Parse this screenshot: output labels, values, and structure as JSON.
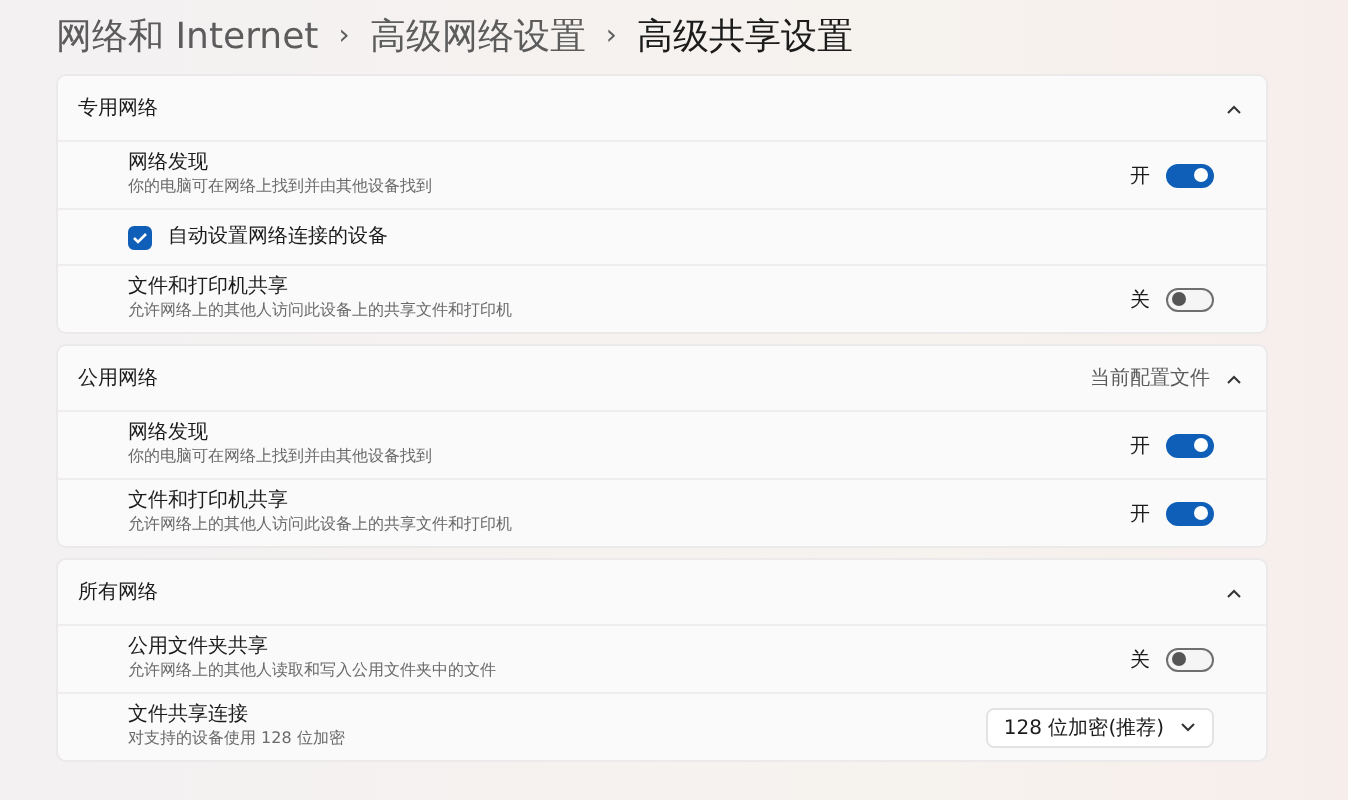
{
  "breadcrumb": [
    {
      "label": "网络和 Internet",
      "current": false
    },
    {
      "separator": "›",
      "label": "高级网络设置",
      "current": false
    },
    {
      "separator": "›",
      "label": "高级共享设置",
      "current": true
    }
  ],
  "sections": [
    {
      "title": "专用网络",
      "expanded": true,
      "rows": [
        {
          "kind": "toggle",
          "title": "网络发现",
          "subtitle": "你的电脑可在网络上找到并由其他设备找到",
          "on": true,
          "state_label": "开"
        },
        {
          "kind": "checkbox",
          "label": "自动设置网络连接的设备",
          "checked": true
        },
        {
          "kind": "toggle",
          "title": "文件和打印机共享",
          "subtitle": "允许网络上的其他人访问此设备上的共享文件和打印机",
          "on": false,
          "state_label": "关"
        }
      ]
    },
    {
      "title": "公用网络",
      "note": "当前配置文件",
      "expanded": true,
      "rows": [
        {
          "kind": "toggle",
          "title": "网络发现",
          "subtitle": "你的电脑可在网络上找到并由其他设备找到",
          "on": true,
          "state_label": "开"
        },
        {
          "kind": "toggle",
          "title": "文件和打印机共享",
          "subtitle": "允许网络上的其他人访问此设备上的共享文件和打印机",
          "on": true,
          "state_label": "开"
        }
      ]
    },
    {
      "title": "所有网络",
      "expanded": true,
      "rows": [
        {
          "kind": "toggle",
          "title": "公用文件夹共享",
          "subtitle": "允许网络上的其他人读取和写入公用文件夹中的文件",
          "on": false,
          "state_label": "关"
        },
        {
          "kind": "dropdown",
          "title": "文件共享连接",
          "subtitle": "对支持的设备使用 128 位加密",
          "value": "128 位加密(推荐)"
        }
      ]
    }
  ]
}
